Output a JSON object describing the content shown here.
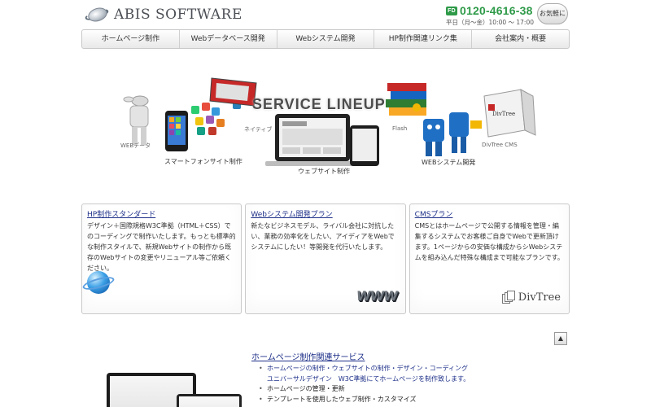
{
  "header": {
    "logo_text": "ABIS SOFTWARE",
    "phone_badge": "FD",
    "phone": "0120-4616-38",
    "hours": "平日（月〜金）10:00 〜 17:00",
    "contact_label": "お気軽に"
  },
  "nav": {
    "items": [
      {
        "label": "ホームページ制作"
      },
      {
        "label": "Webデータベース開発"
      },
      {
        "label": "Webシステム開発"
      },
      {
        "label": "HP制作関連リンク集"
      },
      {
        "label": "会社案内・概要"
      }
    ]
  },
  "hero": {
    "title": "SERVICE LINEUP",
    "captions": {
      "web_database": "WEBデータ",
      "native": "ネイティブ",
      "smartphone": "スマートフォンサイト制作",
      "website": "ウェブサイト制作",
      "flash": "Flash",
      "web_system": "WEBシステム開発",
      "divtree_cms": "DivTree CMS",
      "divtree_box": "DivTree"
    }
  },
  "cards": [
    {
      "title": "HP制作スタンダード",
      "text": "デザイン＋国際規格W3C準拠（HTML＋CSS）でのコーディングで制作いたします。もっとも標準的な制作スタイルで、新規Webサイトの制作から既存のWebサイトの変更やリニューアル等ご依頼ください。"
    },
    {
      "title": "Webシステム開発プラン",
      "text": "新たなビジネスモデル、ライバル会社に対抗したい、業務の効率化をしたい、アイディアをWebでシステムにしたい！等開発を代行いたします。",
      "image_text": "WWW"
    },
    {
      "title": "CMSプラン",
      "text": "CMSとはホームページで公開する情報を管理・編集するシステムでお客様ご自身でWebで更新頂けます。1ページからの安価な構成からシWebシステムを組み込んだ特殊な構成まで可能なプランです。",
      "image_text": "DivTree"
    }
  ],
  "pagetop": "▲",
  "bottom": {
    "title": "ホームページ制作関連サービス",
    "items": [
      {
        "text": "ホームページの制作・ウェブサイトの制作・デザイン・コーディング",
        "type": "link"
      },
      {
        "text": "ユニバーサルデザイン　W3C準拠にてホームページを制作致します。",
        "type": "sub"
      },
      {
        "text": "ホームページの管理・更新",
        "type": "plain"
      },
      {
        "text": "テンプレートを使用したウェブ制作・カスタマイズ",
        "type": "plain"
      }
    ]
  },
  "colors": {
    "link": "#1d2f88",
    "phone_green": "#2e9a48",
    "text": "#333333"
  }
}
